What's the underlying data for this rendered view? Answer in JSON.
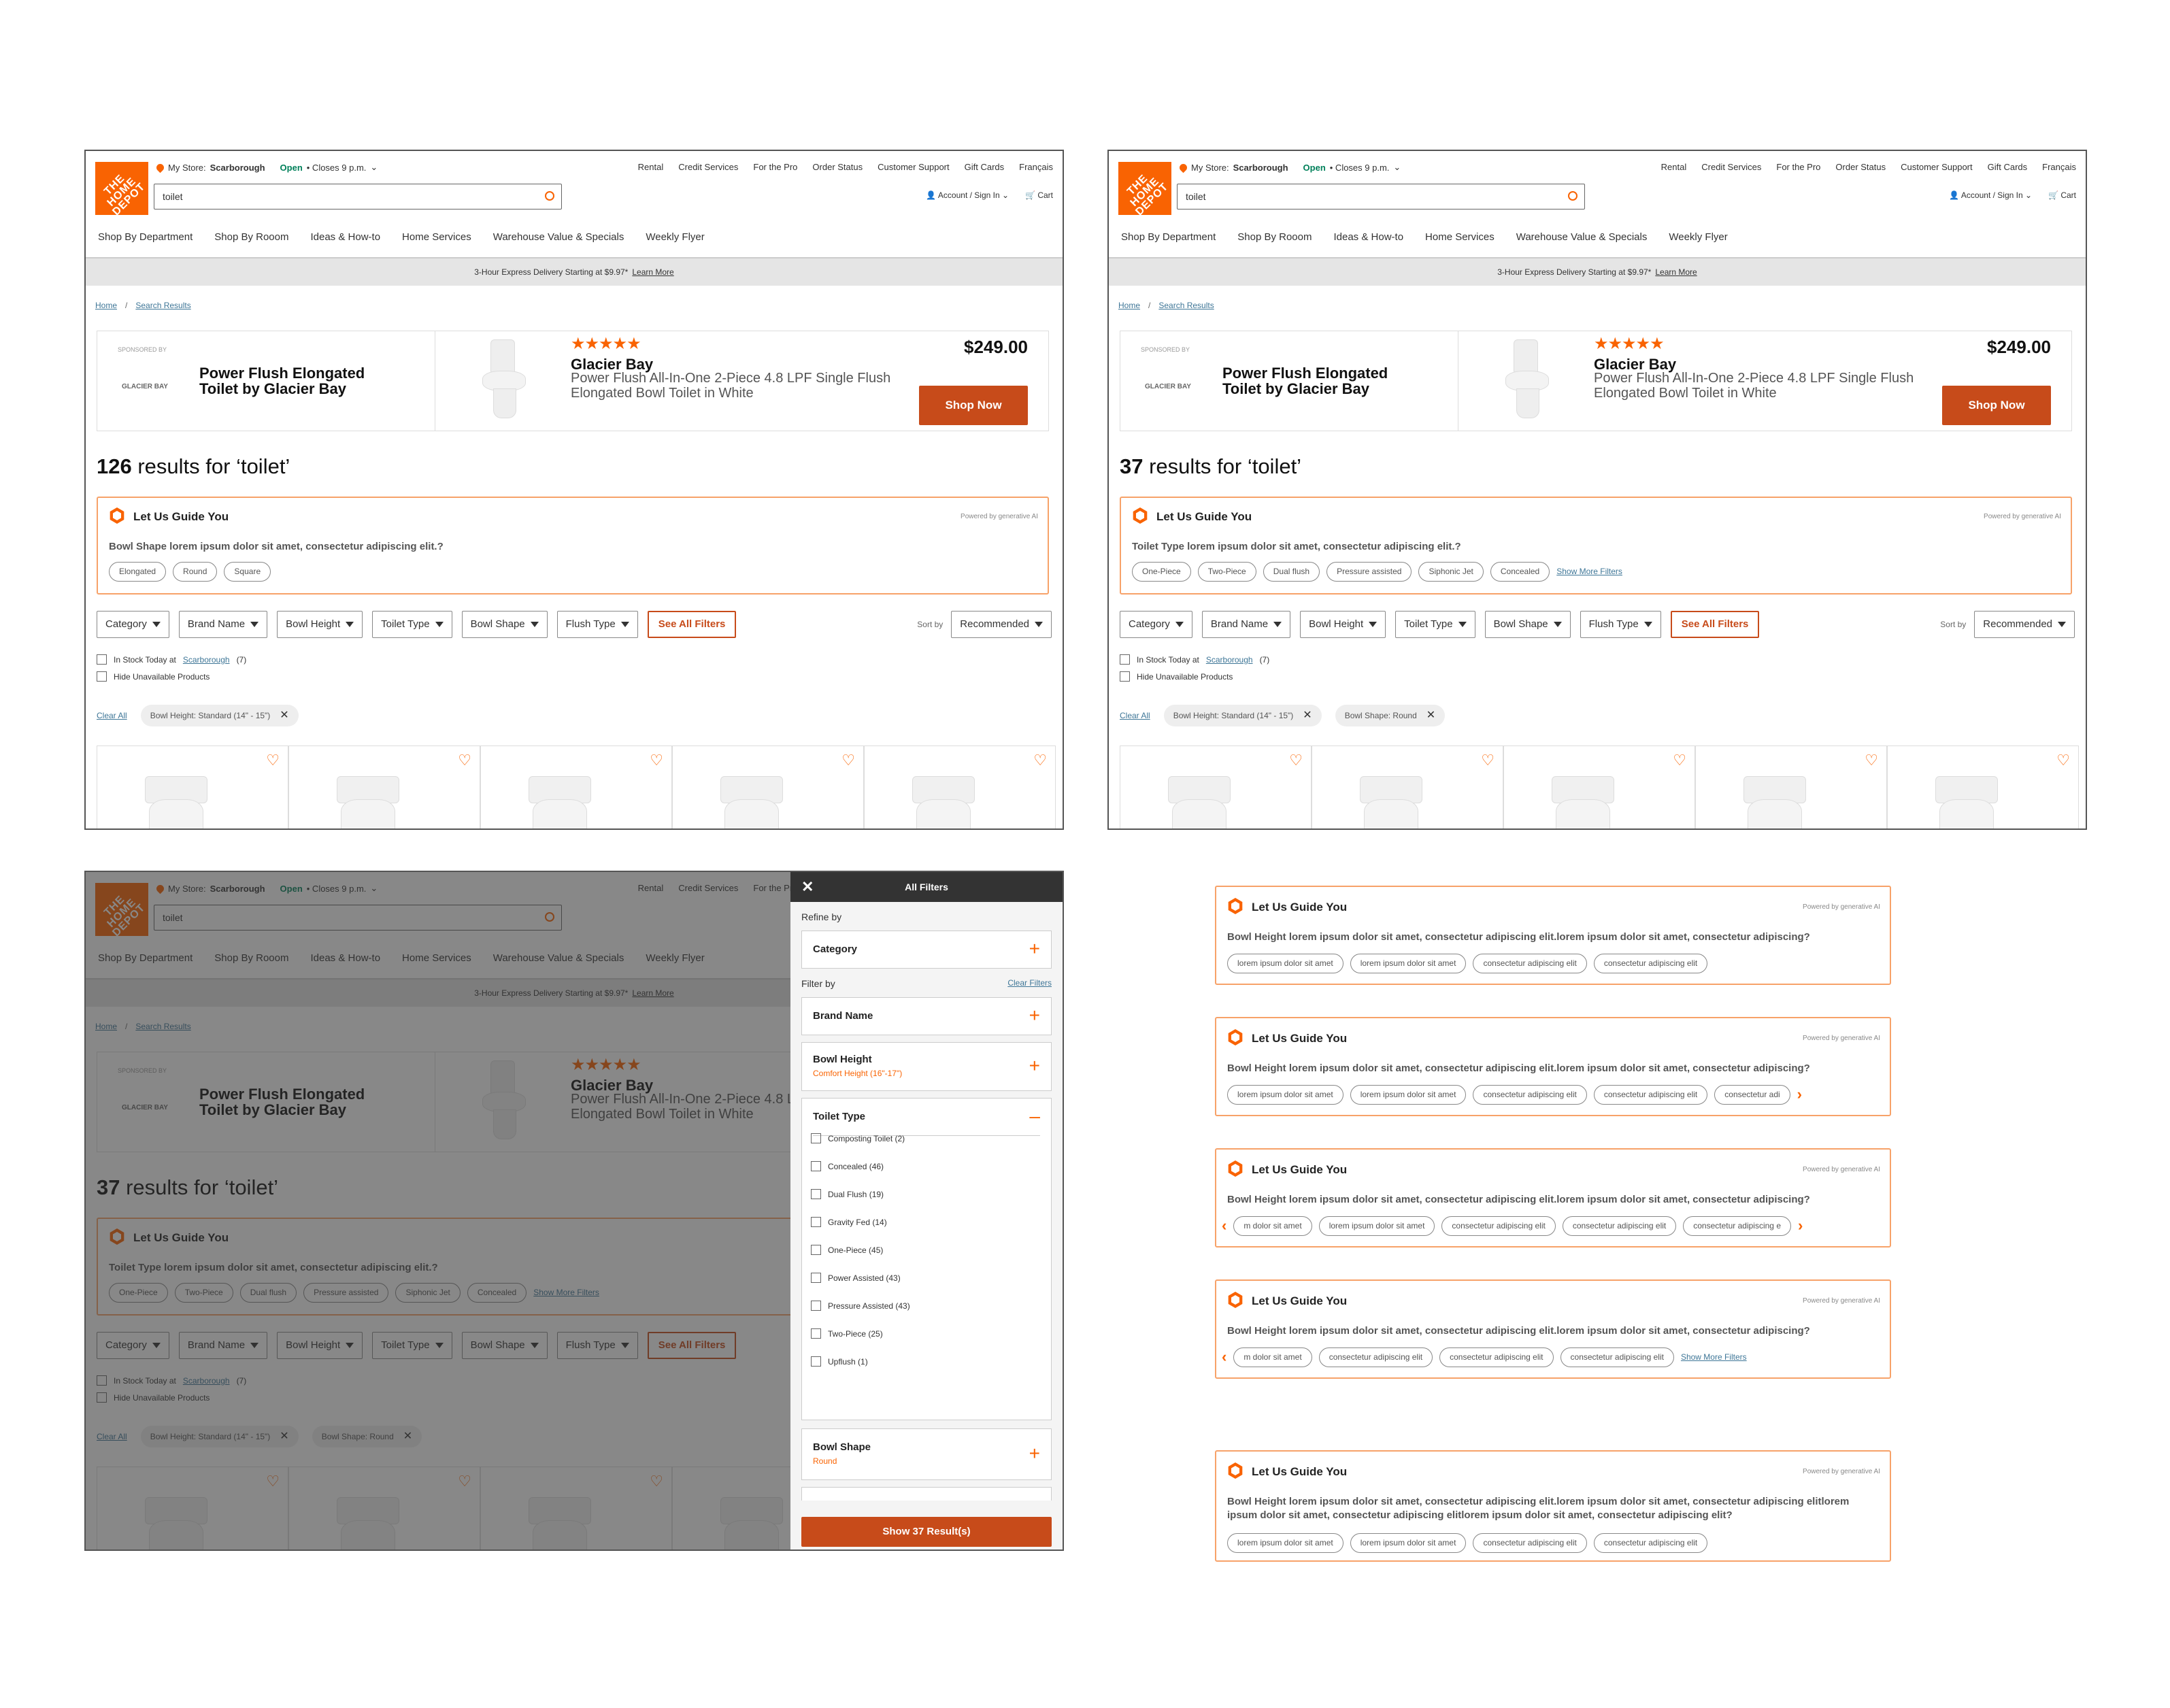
{
  "header": {
    "logo_text": "THE HOME DEPOT",
    "store_label": "My Store:",
    "store_name": "Scarborough",
    "open": "Open",
    "closes": "• Closes 9 p.m.",
    "util": [
      "Rental",
      "Credit Services",
      "For the Pro",
      "Order Status",
      "Customer Support",
      "Gift Cards",
      "Français"
    ],
    "search_value": "toilet",
    "account": "Account / Sign In",
    "cart": "Cart",
    "nav": [
      "Shop By Department",
      "Shop By Rooom",
      "Ideas & How-to",
      "Home Services",
      "Warehouse Value & Specials",
      "Weekly Flyer"
    ],
    "banner": "3-Hour Express Delivery Starting at $9.97*",
    "banner_link": "Learn More"
  },
  "breadcrumb": {
    "home": "Home",
    "sep": "/",
    "current": "Search Results"
  },
  "ad": {
    "sponsored": "SPONSORED BY",
    "brand_logo": "GLACIER BAY",
    "title_line1": "Power Flush Elongated",
    "title_line2": "Toilet by Glacier Bay",
    "stars": "★★★★★",
    "brand": "Glacier Bay",
    "desc": "Power Flush All-In-One 2-Piece 4.8 LPF Single Flush Elongated Bowl Toilet in White",
    "price": "$249.00",
    "button": "Shop Now"
  },
  "frame1": {
    "count": "126",
    "results_label": "results for ‘toilet’",
    "guide_title": "Let Us Guide You",
    "powered": "Powered by generative AI",
    "question": "Bowl Shape lorem ipsum dolor sit amet, consectetur adipiscing elit.?",
    "chips": [
      "Elongated",
      "Round",
      "Square"
    ],
    "applied": [
      "Bowl Height: Standard (14\" - 15\")"
    ]
  },
  "frame2": {
    "count": "37",
    "results_label": "results for ‘toilet’",
    "guide_title": "Let Us Guide You",
    "powered": "Powered by generative AI",
    "question": "Toilet Type lorem ipsum dolor sit amet, consectetur adipiscing elit.?",
    "chips": [
      "One-Piece",
      "Two-Piece",
      "Dual flush",
      "Pressure assisted",
      "Siphonic Jet",
      "Concealed"
    ],
    "show_more": "Show More Filters",
    "applied": [
      "Bowl Height: Standard (14\" - 15\")",
      "Bowl Shape: Round"
    ]
  },
  "filters": {
    "buttons": [
      "Category",
      "Brand Name",
      "Bowl Height",
      "Toilet Type",
      "Bowl Shape",
      "Flush Type"
    ],
    "see_all": "See All Filters",
    "sort_by": "Sort by",
    "sort_value": "Recommended",
    "instock": "In Stock Today at",
    "instock_store": "Scarborough",
    "instock_count": "(7)",
    "hide": "Hide Unavailable Products",
    "clear_all": "Clear All"
  },
  "panel": {
    "title": "All Filters",
    "close": "✕",
    "refine_by": "Refine by",
    "category": "Category",
    "filter_by": "Filter by",
    "clear_filters": "Clear Filters",
    "brand": "Brand Name",
    "bowl_height": "Bowl Height",
    "bowl_height_sel": "Comfort Height (16\"-17\")",
    "toilet_type": "Toilet Type",
    "options": [
      "Composting Toilet (2)",
      "Concealed (46)",
      "Dual Flush (19)",
      "Gravity Fed (14)",
      "One-Piece (45)",
      "Power Assisted (43)",
      "Pressure Assisted (43)",
      "Two-Piece (25)",
      "Upflush (1)"
    ],
    "bowl_shape": "Bowl Shape",
    "bowl_shape_sel": "Round",
    "cta": "Show 37 Result(s)"
  },
  "variants": {
    "title": "Let Us Guide You",
    "powered": "Powered by generative AI",
    "v1": {
      "q": "Bowl Height lorem ipsum dolor sit amet, consectetur adipiscing elit.lorem ipsum dolor sit amet, consectetur adipiscing?",
      "chips": [
        "lorem ipsum dolor sit amet",
        "lorem ipsum dolor sit amet",
        "consectetur adipiscing elit",
        "consectetur adipiscing elit"
      ]
    },
    "v2": {
      "q": "Bowl Height lorem ipsum dolor sit amet, consectetur adipiscing elit.lorem ipsum dolor sit amet, consectetur adipiscing?",
      "chips": [
        "lorem ipsum dolor sit amet",
        "lorem ipsum dolor sit amet",
        "consectetur adipiscing elit",
        "consectetur adipiscing elit",
        "consectetur adi"
      ]
    },
    "v3": {
      "q": "Bowl Height lorem ipsum dolor sit amet, consectetur adipiscing elit.lorem ipsum dolor sit amet, consectetur adipiscing?",
      "chips": [
        "m dolor sit amet",
        "lorem ipsum dolor sit amet",
        "consectetur adipiscing elit",
        "consectetur adipiscing elit",
        "consectetur adipiscing e"
      ]
    },
    "v4": {
      "q": "Bowl Height lorem ipsum dolor sit amet, consectetur adipiscing elit.lorem ipsum dolor sit amet, consectetur adipiscing?",
      "chips": [
        "m dolor sit amet",
        "consectetur adipiscing elit",
        "consectetur adipiscing elit",
        "consectetur adipiscing elit"
      ],
      "show_more": "Show More Filters"
    },
    "v5": {
      "q": "Bowl Height lorem ipsum dolor sit amet, consectetur adipiscing elit.lorem ipsum dolor sit amet, consectetur adipiscing elitlorem ipsum dolor sit amet, consectetur adipiscing elitlorem ipsum dolor sit amet, consectetur adipiscing elit?",
      "chips": [
        "lorem ipsum dolor sit amet",
        "lorem ipsum dolor sit amet",
        "consectetur adipiscing elit",
        "consectetur adipiscing elit"
      ]
    }
  },
  "icons": {
    "heart": "heart-icon",
    "close": "close-icon",
    "plus": "plus-icon",
    "minus": "minus-icon",
    "arrow_left": "chevron-left-icon",
    "arrow_right": "chevron-right-icon"
  },
  "colors": {
    "brand": "#f96302",
    "cta": "#c74b1a",
    "link": "#3e7697",
    "guide_border": "#f7a269"
  }
}
